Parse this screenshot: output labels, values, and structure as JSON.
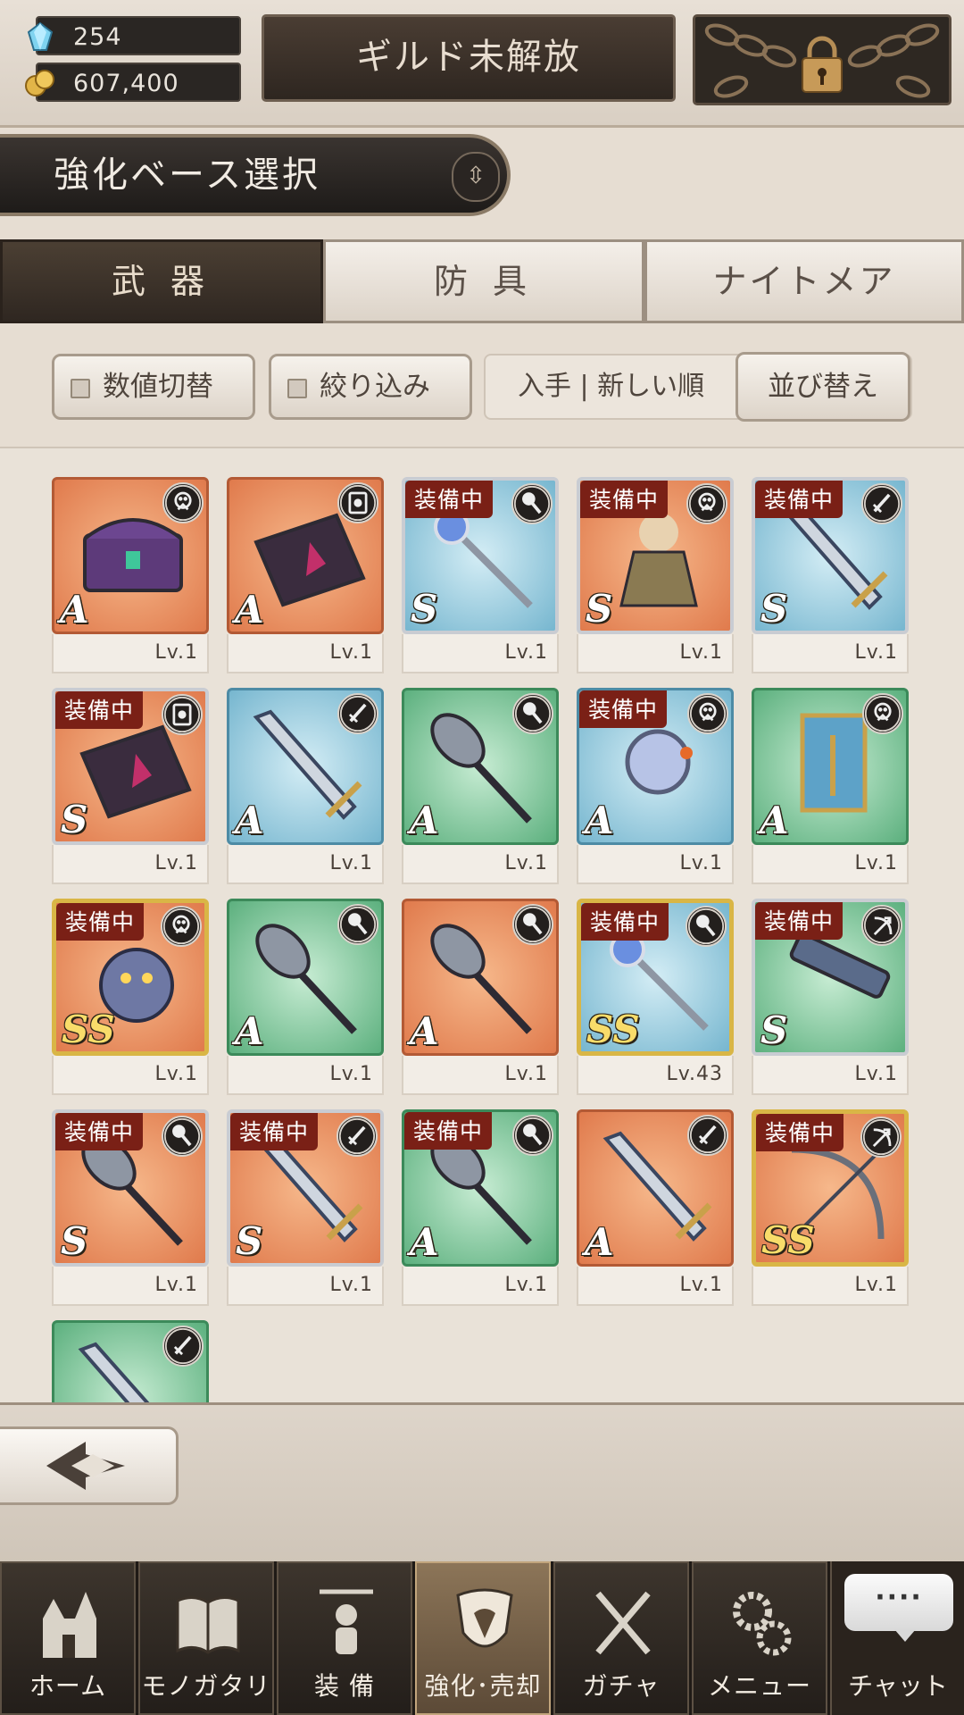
{
  "header": {
    "gems": "254",
    "gold": "607,400",
    "guild_button": "ギルド未解放"
  },
  "title": {
    "label": "強化ベース選択",
    "switch_icon": "up-down-chevron-icon"
  },
  "tabs": [
    {
      "label": "武 器",
      "active": true
    },
    {
      "label": "防 具",
      "active": false
    },
    {
      "label": "ナイトメア",
      "active": false
    }
  ],
  "filters": {
    "toggle_values": "数値切替",
    "filter": "絞り込み",
    "sort_current": "入手 | 新しい順",
    "sort_button": "並び替え"
  },
  "items": [
    {
      "rank": "A",
      "equipped": false,
      "color": "orange",
      "type": "staff",
      "art": "chest",
      "level": "Lv.1"
    },
    {
      "rank": "A",
      "equipped": false,
      "color": "orange",
      "type": "tome",
      "art": "book",
      "level": "Lv.1"
    },
    {
      "rank": "S",
      "equipped": true,
      "color": "blue",
      "type": "mace",
      "art": "wand",
      "level": "Lv.1"
    },
    {
      "rank": "S",
      "equipped": true,
      "color": "orange",
      "type": "staff",
      "art": "doll",
      "level": "Lv.1"
    },
    {
      "rank": "S",
      "equipped": true,
      "color": "blue",
      "type": "sword",
      "art": "spear",
      "level": "Lv.1"
    },
    {
      "rank": "S",
      "equipped": true,
      "color": "orange",
      "type": "tome",
      "art": "book2",
      "level": "Lv.1"
    },
    {
      "rank": "A",
      "equipped": false,
      "color": "blue",
      "type": "sword",
      "art": "blade",
      "level": "Lv.1"
    },
    {
      "rank": "A",
      "equipped": false,
      "color": "green",
      "type": "mace",
      "art": "mace",
      "level": "Lv.1"
    },
    {
      "rank": "A",
      "equipped": true,
      "color": "blue",
      "type": "staff",
      "art": "orb",
      "level": "Lv.1"
    },
    {
      "rank": "A",
      "equipped": false,
      "color": "green",
      "type": "staff",
      "art": "banner",
      "level": "Lv.1"
    },
    {
      "rank": "SS",
      "equipped": true,
      "color": "orange",
      "type": "staff",
      "art": "creature",
      "level": "Lv.1",
      "frame": "gold"
    },
    {
      "rank": "A",
      "equipped": false,
      "color": "green",
      "type": "mace",
      "art": "mace",
      "level": "Lv.1"
    },
    {
      "rank": "A",
      "equipped": false,
      "color": "orange",
      "type": "mace",
      "art": "club",
      "level": "Lv.1"
    },
    {
      "rank": "SS",
      "equipped": true,
      "color": "blue",
      "type": "mace",
      "art": "wand2",
      "level": "Lv.43",
      "frame": "gold"
    },
    {
      "rank": "S",
      "equipped": true,
      "color": "green",
      "type": "bow",
      "art": "gun",
      "level": "Lv.1"
    },
    {
      "rank": "S",
      "equipped": true,
      "color": "orange",
      "type": "mace",
      "art": "hammer",
      "level": "Lv.1"
    },
    {
      "rank": "S",
      "equipped": true,
      "color": "orange",
      "type": "sword",
      "art": "blade2",
      "level": "Lv.1"
    },
    {
      "rank": "A",
      "equipped": true,
      "color": "green",
      "type": "mace",
      "art": "axe",
      "level": "Lv.1"
    },
    {
      "rank": "A",
      "equipped": false,
      "color": "orange",
      "type": "sword",
      "art": "sword",
      "level": "Lv.1"
    },
    {
      "rank": "SS",
      "equipped": true,
      "color": "orange",
      "type": "bow",
      "art": "bow",
      "level": "Lv.1",
      "frame": "gold"
    },
    {
      "rank": "",
      "equipped": false,
      "color": "green",
      "type": "sword",
      "art": "blade3",
      "level": "",
      "partial": true
    }
  ],
  "equipped_label": "装備中",
  "nav": [
    {
      "label": "ホーム",
      "icon": "castle-icon",
      "active": false
    },
    {
      "label": "モノガタリ",
      "icon": "open-book-icon",
      "active": false
    },
    {
      "label": "装 備",
      "icon": "puppet-icon",
      "active": false
    },
    {
      "label": "強化･売却",
      "icon": "shield-icon",
      "active": true
    },
    {
      "label": "ガチャ",
      "icon": "crossed-swords-icon",
      "active": false
    },
    {
      "label": "メニュー",
      "icon": "gears-icon",
      "active": false
    }
  ],
  "chat": {
    "bubble": "····",
    "label": "チャット"
  },
  "colors": {
    "equipped_badge": "#7a2016",
    "active_tab": "#3b3129",
    "ss_frame": "#d9b646"
  }
}
